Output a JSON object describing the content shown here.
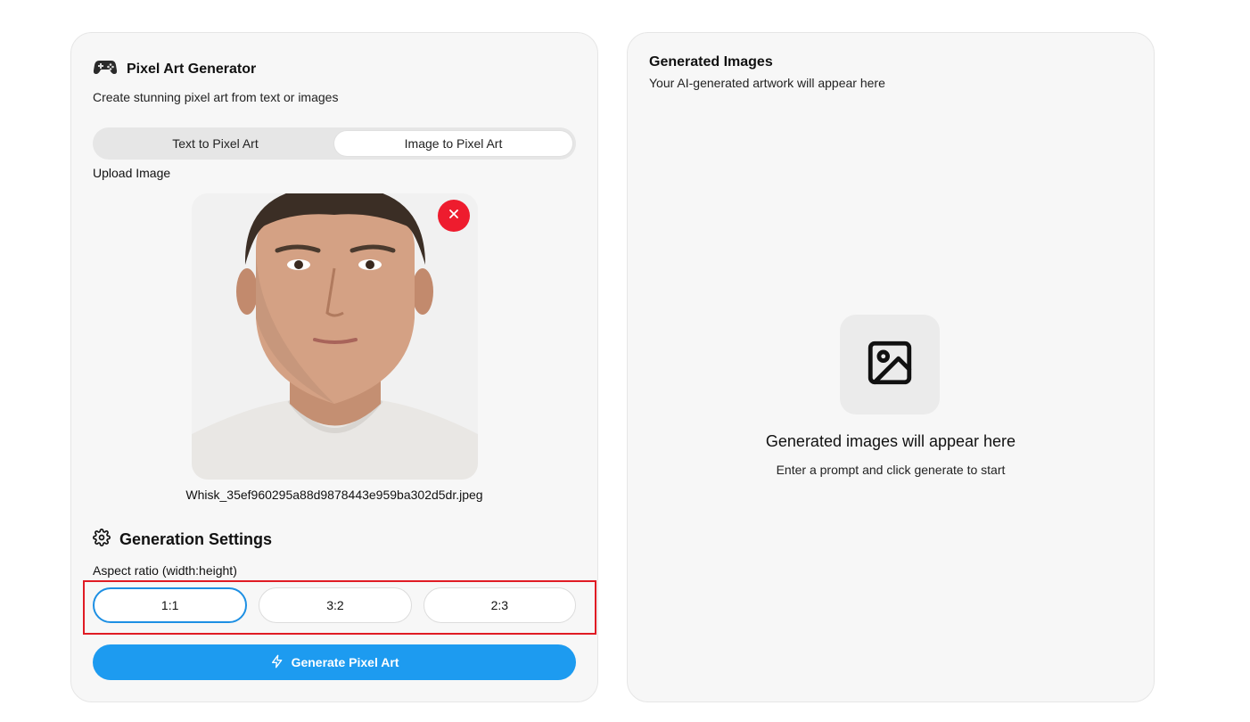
{
  "generator": {
    "title": "Pixel Art Generator",
    "subtitle": "Create stunning pixel art from text or images",
    "header_icon": "gamepad-icon"
  },
  "tabs": [
    {
      "label": "Text to Pixel Art",
      "active": false
    },
    {
      "label": "Image to Pixel Art",
      "active": true
    }
  ],
  "upload": {
    "label": "Upload Image",
    "filename": "Whisk_35ef960295a88d9878443e959ba302d5dr.jpeg",
    "remove_icon": "close-icon"
  },
  "settings": {
    "title": "Generation Settings",
    "icon": "gear-icon",
    "aspect_label": "Aspect ratio (width:height)",
    "ratios": [
      {
        "label": "1:1",
        "selected": true
      },
      {
        "label": "3:2",
        "selected": false
      },
      {
        "label": "2:3",
        "selected": false
      }
    ]
  },
  "generate_button": {
    "label": "Generate Pixel Art",
    "icon": "lightning-icon"
  },
  "results": {
    "title": "Generated Images",
    "subtitle": "Your AI-generated artwork will appear here",
    "empty_icon": "image-icon",
    "empty_title": "Generated images will appear here",
    "empty_subtitle": "Enter a prompt and click generate to start"
  },
  "colors": {
    "accent": "#1d9bf0",
    "selected_border": "#1d8fe3",
    "remove": "#ee1c2e",
    "highlight": "#e01b24",
    "card_bg": "#f7f7f7"
  }
}
